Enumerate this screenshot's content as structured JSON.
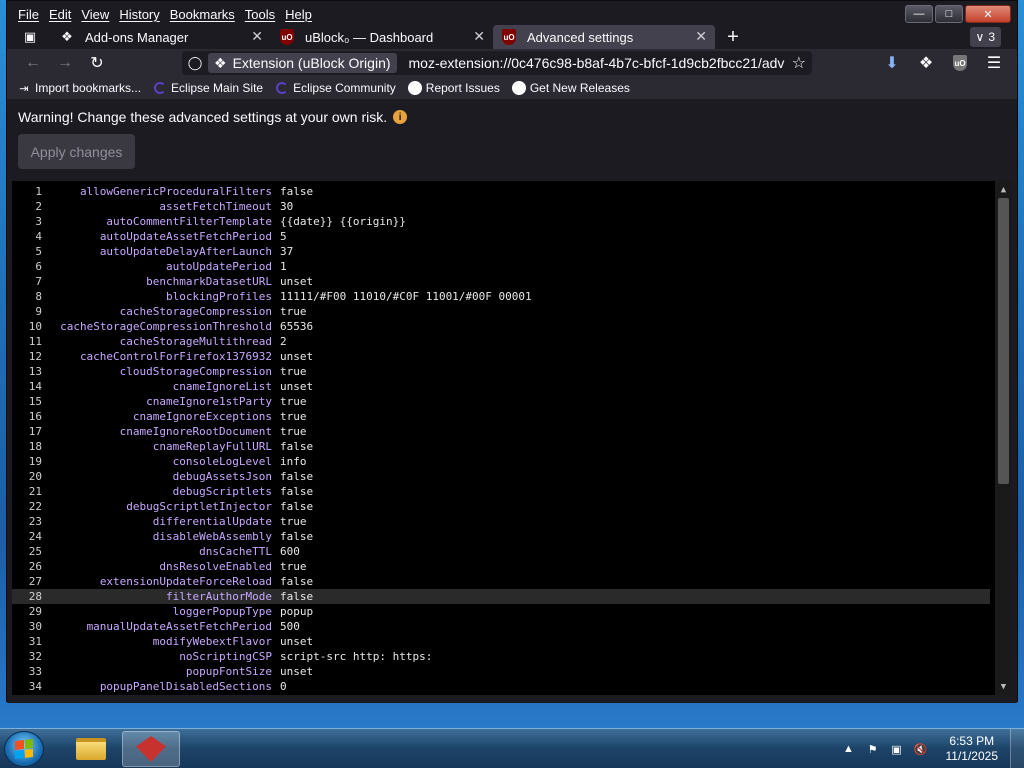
{
  "menubar": {
    "items": [
      "File",
      "Edit",
      "View",
      "History",
      "Bookmarks",
      "Tools",
      "Help"
    ]
  },
  "tabs": [
    {
      "label": "Add-ons Manager",
      "icon": "puzzle-icon",
      "active": false
    },
    {
      "label": "uBlock₀ — Dashboard",
      "icon": "ublock-icon",
      "active": false
    },
    {
      "label": "Advanced settings",
      "icon": "ublock-icon",
      "active": true
    }
  ],
  "tab_count": "3",
  "urlbar": {
    "identity": "Extension (uBlock Origin)",
    "url": "moz-extension://0c476c98-b8af-4b7c-bfcf-1d9cb2fbcc21/adv"
  },
  "bookmarks": [
    {
      "label": "Import bookmarks...",
      "icon": "import-icon"
    },
    {
      "label": "Eclipse Main Site",
      "icon": "eclipse-icon"
    },
    {
      "label": "Eclipse Community",
      "icon": "eclipse-icon"
    },
    {
      "label": "Report Issues",
      "icon": "github-icon"
    },
    {
      "label": "Get New Releases",
      "icon": "github-icon"
    }
  ],
  "page": {
    "warning": "Warning! Change these advanced settings at your own risk.",
    "apply_label": "Apply changes"
  },
  "settings": [
    {
      "n": "1",
      "key": "allowGenericProceduralFilters",
      "value": "false"
    },
    {
      "n": "2",
      "key": "assetFetchTimeout",
      "value": "30"
    },
    {
      "n": "3",
      "key": "autoCommentFilterTemplate",
      "value": "{{date}} {{origin}}"
    },
    {
      "n": "4",
      "key": "autoUpdateAssetFetchPeriod",
      "value": "5"
    },
    {
      "n": "5",
      "key": "autoUpdateDelayAfterLaunch",
      "value": "37"
    },
    {
      "n": "6",
      "key": "autoUpdatePeriod",
      "value": "1"
    },
    {
      "n": "7",
      "key": "benchmarkDatasetURL",
      "value": "unset"
    },
    {
      "n": "8",
      "key": "blockingProfiles",
      "value": "11111/#F00 11010/#C0F 11001/#00F 00001"
    },
    {
      "n": "9",
      "key": "cacheStorageCompression",
      "value": "true"
    },
    {
      "n": "10",
      "key": "cacheStorageCompressionThreshold",
      "value": "65536"
    },
    {
      "n": "11",
      "key": "cacheStorageMultithread",
      "value": "2"
    },
    {
      "n": "12",
      "key": "cacheControlForFirefox1376932",
      "value": "unset"
    },
    {
      "n": "13",
      "key": "cloudStorageCompression",
      "value": "true"
    },
    {
      "n": "14",
      "key": "cnameIgnoreList",
      "value": "unset"
    },
    {
      "n": "15",
      "key": "cnameIgnore1stParty",
      "value": "true"
    },
    {
      "n": "16",
      "key": "cnameIgnoreExceptions",
      "value": "true"
    },
    {
      "n": "17",
      "key": "cnameIgnoreRootDocument",
      "value": "true"
    },
    {
      "n": "18",
      "key": "cnameReplayFullURL",
      "value": "false"
    },
    {
      "n": "19",
      "key": "consoleLogLevel",
      "value": "info"
    },
    {
      "n": "20",
      "key": "debugAssetsJson",
      "value": "false"
    },
    {
      "n": "21",
      "key": "debugScriptlets",
      "value": "false"
    },
    {
      "n": "22",
      "key": "debugScriptletInjector",
      "value": "false"
    },
    {
      "n": "23",
      "key": "differentialUpdate",
      "value": "true"
    },
    {
      "n": "24",
      "key": "disableWebAssembly",
      "value": "false"
    },
    {
      "n": "25",
      "key": "dnsCacheTTL",
      "value": "600"
    },
    {
      "n": "26",
      "key": "dnsResolveEnabled",
      "value": "true"
    },
    {
      "n": "27",
      "key": "extensionUpdateForceReload",
      "value": "false"
    },
    {
      "n": "28",
      "key": "filterAuthorMode",
      "value": "false"
    },
    {
      "n": "29",
      "key": "loggerPopupType",
      "value": "popup"
    },
    {
      "n": "30",
      "key": "manualUpdateAssetFetchPeriod",
      "value": "500"
    },
    {
      "n": "31",
      "key": "modifyWebextFlavor",
      "value": "unset"
    },
    {
      "n": "32",
      "key": "noScriptingCSP",
      "value": "script-src http: https:"
    },
    {
      "n": "33",
      "key": "popupFontSize",
      "value": "unset"
    },
    {
      "n": "34",
      "key": "popupPanelDisabledSections",
      "value": "0"
    }
  ],
  "highlighted_line": "28",
  "taskbar": {
    "time": "6:53 PM",
    "date": "11/1/2025"
  },
  "colors": {
    "key": "#c7a7ff",
    "value": "#e8e8e8",
    "editor_bg": "#000000",
    "chrome_bg": "#1c1b22"
  }
}
